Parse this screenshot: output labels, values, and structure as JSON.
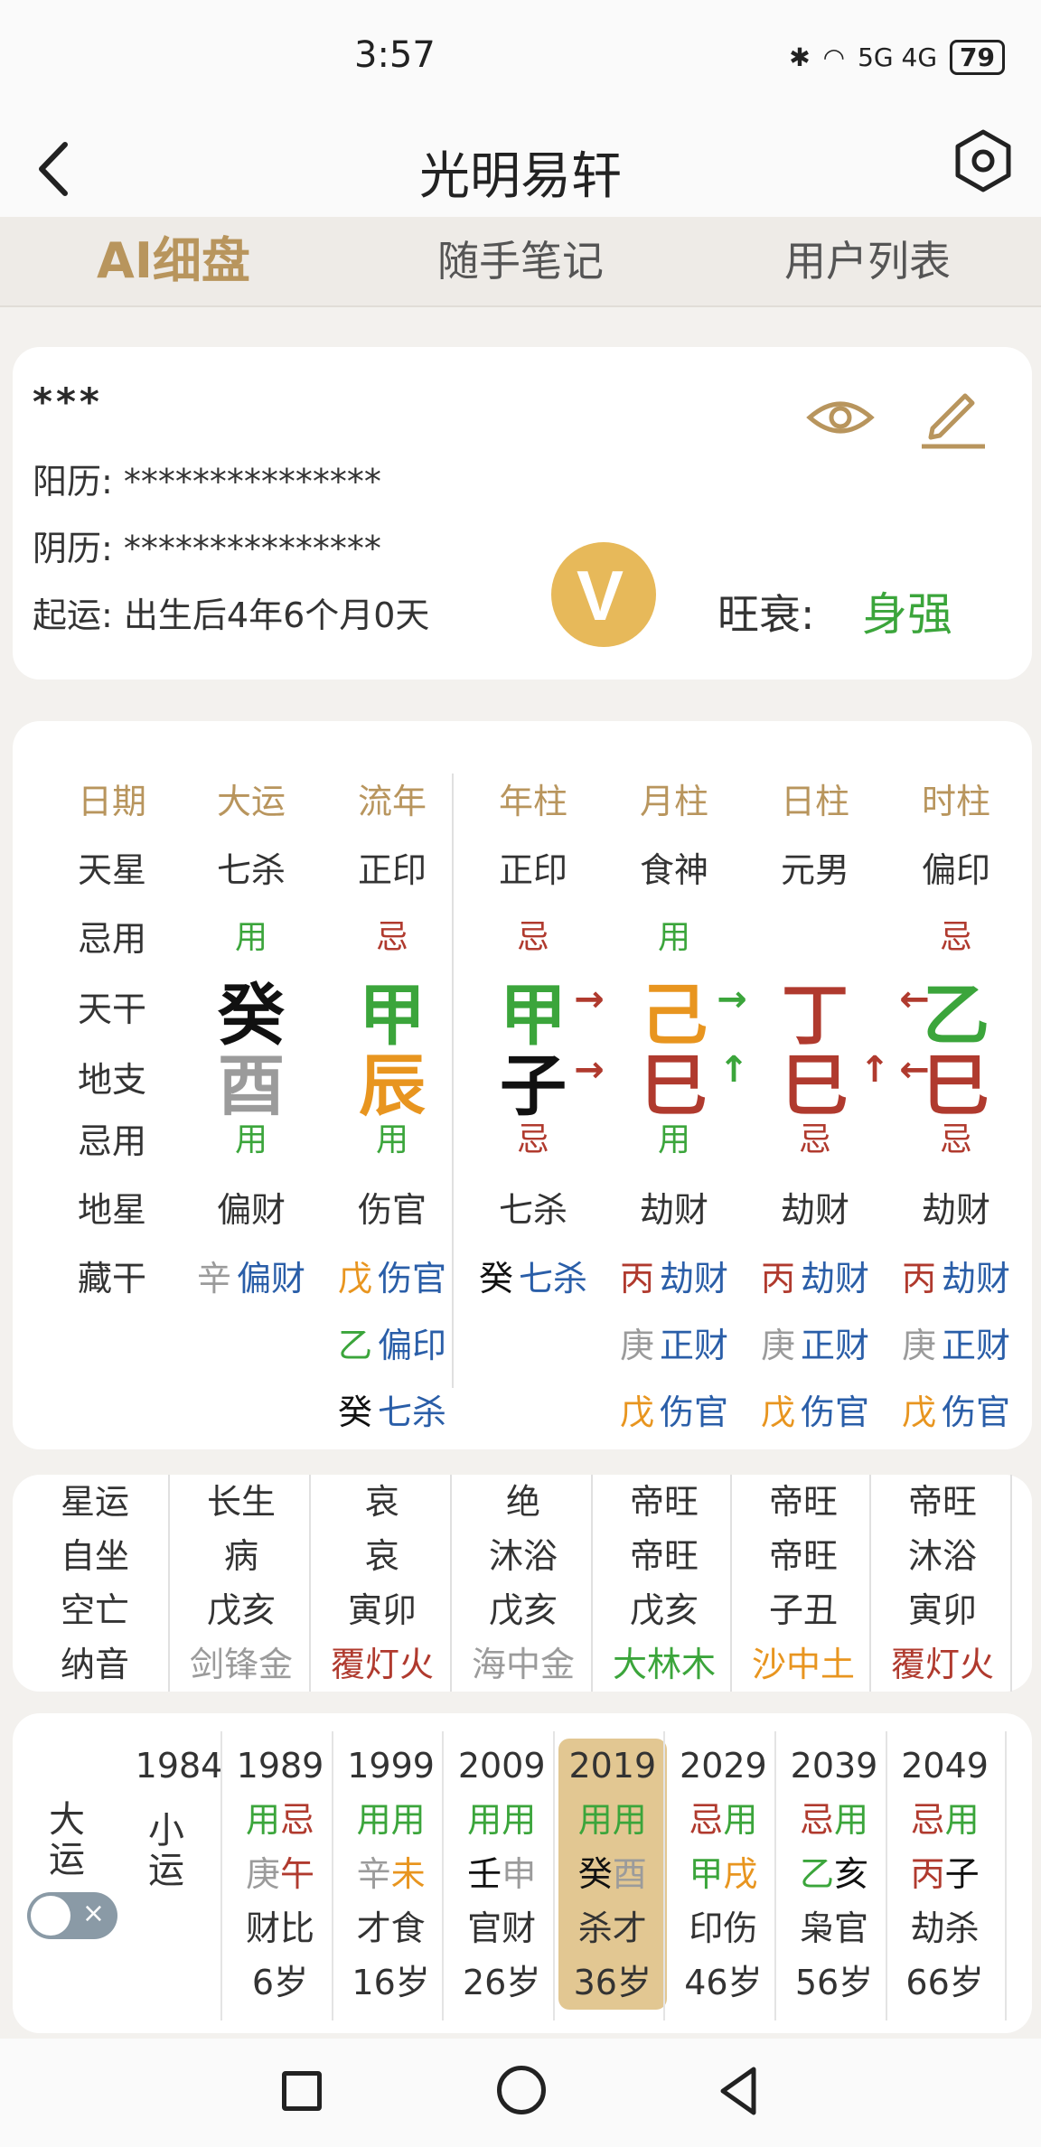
{
  "status_bar": {
    "time": "3:57",
    "network": "5G 4G",
    "battery": "79"
  },
  "header": {
    "title": "光明易轩"
  },
  "tabs": [
    "AI细盘",
    "随手笔记",
    "用户列表"
  ],
  "profile": {
    "name": "***",
    "solar_label": "阳历:",
    "solar_value": "***************",
    "lunar_label": "阴历:",
    "lunar_value": "***************",
    "qiyun_label": "起运:",
    "qiyun_value": "出生后4年6个月0天",
    "wangshuai_label": "旺衰:",
    "wangshuai_value": "身强",
    "vip_text": "V"
  },
  "chart": {
    "columns": [
      "大运",
      "流年",
      "年柱",
      "月柱",
      "日柱",
      "时柱"
    ],
    "row_labels": [
      "日期",
      "天星",
      "忌用",
      "天干",
      "地支",
      "忌用",
      "地星",
      "藏干"
    ],
    "tianxing": [
      "七杀",
      "正印",
      "正印",
      "食神",
      "元男",
      "偏印"
    ],
    "jiyong_top": [
      "用",
      "忌",
      "忌",
      "用",
      "",
      "忌"
    ],
    "tiangan": [
      "癸",
      "甲",
      "甲",
      "己",
      "丁",
      "乙"
    ],
    "dizhi": [
      "酉",
      "辰",
      "子",
      "巳",
      "巳",
      "巳"
    ],
    "jiyong_bottom": [
      "用",
      "用",
      "忌",
      "用",
      "忌",
      "忌"
    ],
    "dixing": [
      "偏财",
      "伤官",
      "七杀",
      "劫财",
      "劫财",
      "劫财"
    ],
    "arrows": {
      "right": "→",
      "left": "←",
      "up": "↑"
    },
    "canggan": [
      [
        [
          "辛",
          "偏财"
        ]
      ],
      [
        [
          "戊",
          "伤官"
        ],
        [
          "乙",
          "偏印"
        ],
        [
          "癸",
          "七杀"
        ]
      ],
      [
        [
          "癸",
          "七杀"
        ]
      ],
      [
        [
          "丙",
          "劫财"
        ],
        [
          "庚",
          "正财"
        ],
        [
          "戊",
          "伤官"
        ]
      ],
      [
        [
          "丙",
          "劫财"
        ],
        [
          "庚",
          "正财"
        ],
        [
          "戊",
          "伤官"
        ]
      ],
      [
        [
          "丙",
          "劫财"
        ],
        [
          "庚",
          "正财"
        ],
        [
          "戊",
          "伤官"
        ]
      ]
    ]
  },
  "info": {
    "labels": [
      "星运",
      "自坐",
      "空亡",
      "纳音"
    ],
    "columns": [
      [
        "长生",
        "病",
        "戊亥",
        "剑锋金"
      ],
      [
        "哀",
        "哀",
        "寅卯",
        "覆灯火"
      ],
      [
        "绝",
        "沐浴",
        "戊亥",
        "海中金"
      ],
      [
        "帝旺",
        "帝旺",
        "戊亥",
        "大林木"
      ],
      [
        "帝旺",
        "帝旺",
        "子丑",
        "沙中土"
      ],
      [
        "帝旺",
        "沐浴",
        "寅卯",
        "覆灯火"
      ]
    ]
  },
  "dayun": {
    "label_dayun": "大运",
    "label_xiaoyun": "小运",
    "toggle_x": "×",
    "first_year": "1984",
    "columns": [
      {
        "year": "1989",
        "jy": [
          "用",
          "忌"
        ],
        "gz": [
          "庚",
          "午"
        ],
        "ss": "财比",
        "age": "6岁"
      },
      {
        "year": "1999",
        "jy": [
          "用",
          "用"
        ],
        "gz": [
          "辛",
          "未"
        ],
        "ss": "才食",
        "age": "16岁"
      },
      {
        "year": "2009",
        "jy": [
          "用",
          "用"
        ],
        "gz": [
          "壬",
          "申"
        ],
        "ss": "官财",
        "age": "26岁"
      },
      {
        "year": "2019",
        "jy": [
          "用",
          "用"
        ],
        "gz": [
          "癸",
          "酉"
        ],
        "ss": "杀才",
        "age": "36岁"
      },
      {
        "year": "2029",
        "jy": [
          "忌",
          "用"
        ],
        "gz": [
          "甲",
          "戌"
        ],
        "ss": "印伤",
        "age": "46岁"
      },
      {
        "year": "2039",
        "jy": [
          "忌",
          "用"
        ],
        "gz": [
          "乙",
          "亥"
        ],
        "ss": "枭官",
        "age": "56岁"
      },
      {
        "year": "2049",
        "jy": [
          "忌",
          "用"
        ],
        "gz": [
          "丙",
          "子"
        ],
        "ss": "劫杀",
        "age": "66岁"
      }
    ]
  },
  "colors": {
    "gold": "#b8955d",
    "red": "#b03a2e",
    "green": "#3ba53b",
    "orange": "#e8951f",
    "gray": "#9b9b9b",
    "blue": "#2a5ea8",
    "selected": "#e2c792"
  }
}
